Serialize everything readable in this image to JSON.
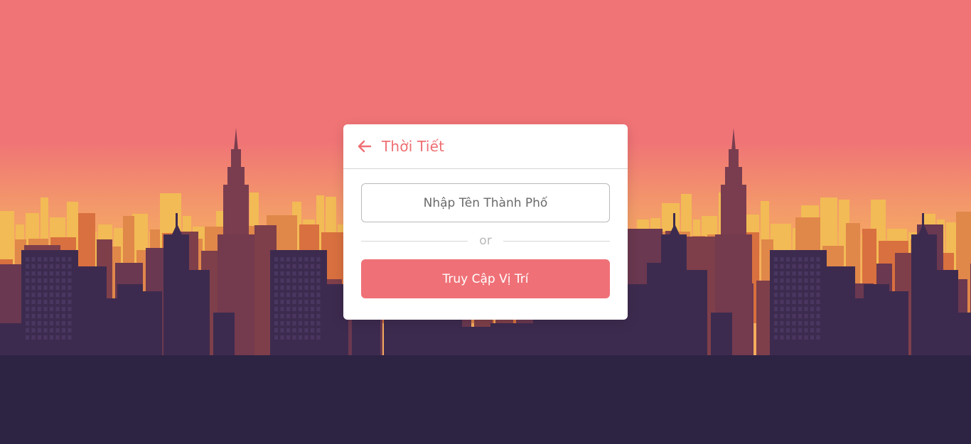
{
  "app": {
    "title": "Thời Tiết",
    "accent_color": "#ef7177",
    "back_icon": "arrow-left-icon"
  },
  "form": {
    "city_placeholder": "Nhập Tên Thành Phố",
    "city_value": "",
    "separator_text": "or",
    "location_button_label": "Truy Cập Vị Trí"
  },
  "background": {
    "sky_top_color": "#f07476",
    "sky_horizon_color": "#f6a35a",
    "ground_color": "#2d2444"
  }
}
